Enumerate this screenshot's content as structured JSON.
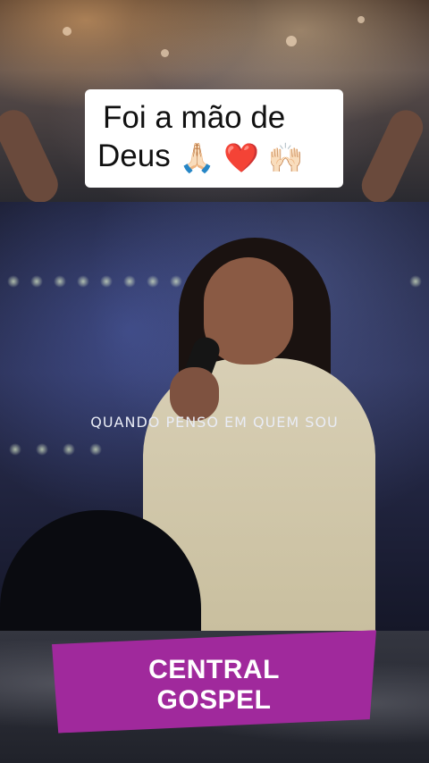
{
  "caption": {
    "line1": "Foi a mão de",
    "line2": "Deus",
    "emojis": [
      "🙏🏻",
      "❤️",
      "🙌🏻"
    ]
  },
  "lyric": "QUANDO PENSO EM QUEM SOU",
  "brand": {
    "line1": "CENTRAL",
    "line2": "GOSPEL",
    "color": "#a0299c"
  }
}
